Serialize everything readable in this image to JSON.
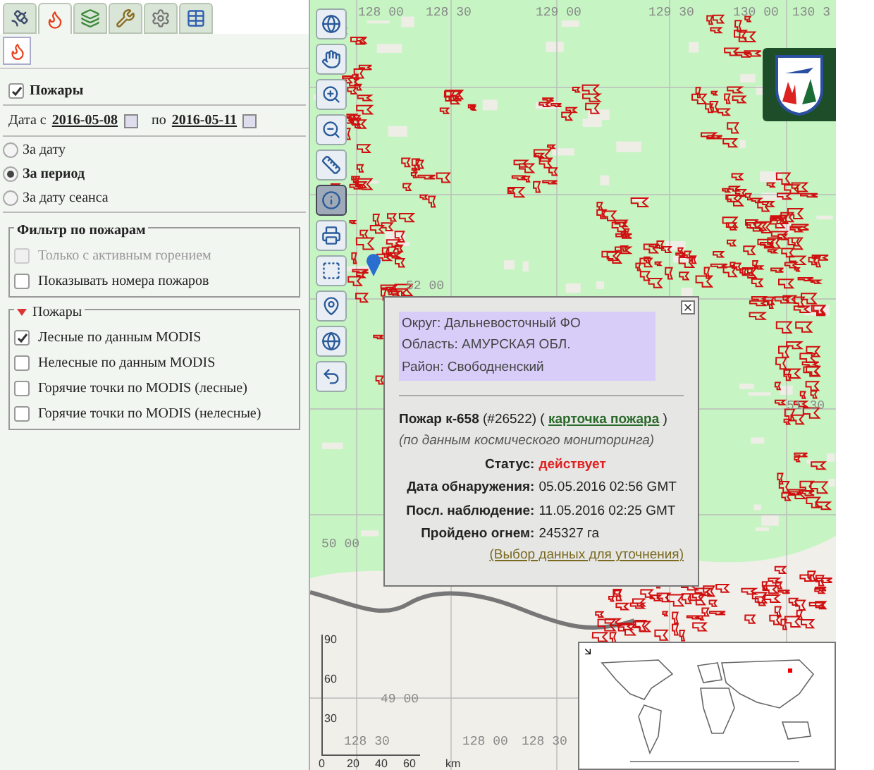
{
  "tabs": [
    {
      "kind": "satellite",
      "selected": false
    },
    {
      "kind": "fire",
      "selected": true
    },
    {
      "kind": "layers",
      "selected": false
    },
    {
      "kind": "tools",
      "selected": false
    },
    {
      "kind": "settings",
      "selected": false
    },
    {
      "kind": "table",
      "selected": false
    }
  ],
  "subtabs": [
    {
      "kind": "fire",
      "selected": true
    }
  ],
  "layer": {
    "label": "Пожары",
    "checked": true
  },
  "date_range": {
    "from_label": "Дата с",
    "from": "2016-05-08",
    "to_label": "по",
    "to": "2016-05-11"
  },
  "modes": [
    {
      "label": "За дату",
      "selected": false
    },
    {
      "label": "За период",
      "selected": true
    },
    {
      "label": "За дату сеанса",
      "selected": false
    }
  ],
  "filter": {
    "title": "Фильтр по пожарам",
    "options": [
      {
        "label": "Только с активным горением",
        "checked": false,
        "disabled": true
      },
      {
        "label": "Показывать номера пожаров",
        "checked": false,
        "disabled": false
      }
    ]
  },
  "fires_group": {
    "title": "Пожары",
    "expanded": true,
    "options": [
      {
        "label": "Лесные по данным MODIS",
        "checked": true
      },
      {
        "label": "Нелесные по данным MODIS",
        "checked": false
      },
      {
        "label": "Горячие точки по MODIS (лесные)",
        "checked": false
      },
      {
        "label": "Горячие точки по MODIS (нелесные)",
        "checked": false
      }
    ]
  },
  "map": {
    "toolbar": [
      {
        "kind": "zoom-world",
        "selected": false
      },
      {
        "kind": "pan",
        "selected": false
      },
      {
        "kind": "zoom-box",
        "selected": false
      },
      {
        "kind": "zoom-out",
        "selected": false
      },
      {
        "kind": "ruler",
        "selected": false
      },
      {
        "kind": "info",
        "selected": true
      },
      {
        "kind": "print",
        "selected": false
      },
      {
        "kind": "select",
        "selected": false
      },
      {
        "kind": "pin",
        "selected": false
      },
      {
        "kind": "globe",
        "selected": false
      },
      {
        "kind": "undo",
        "selected": false
      }
    ],
    "grid_labels": [
      "128 00",
      "128 30",
      "129 00",
      "129 30",
      "130 00",
      "130 3",
      "52 00",
      "51 30",
      "50 00",
      "49 00",
      "128 30",
      "128 00",
      "128 30"
    ],
    "popup": {
      "region_lines": [
        "Округ: Дальневосточный ФО",
        "Область: АМУРСКАЯ ОБЛ.",
        "Район: Свободненский"
      ],
      "heading": "**Пожар к-658** (#26522) (",
      "card_link": "карточка пожара",
      "heading_end": ")",
      "source": "(по данным космического мониторинга)",
      "fields": [
        {
          "label": "Статус:",
          "value": "действует",
          "kind": "status"
        },
        {
          "label": "Дата обнаружения:",
          "value": "05.05.2016 02:56 GMT",
          "kind": "plain"
        },
        {
          "label": "Посл. наблюдение:",
          "value": "11.05.2016 02:25 GMT",
          "kind": "plain"
        },
        {
          "label": "Пройдено огнем:",
          "value": "245327 га",
          "kind": "plain"
        }
      ],
      "refine_link": "(Выбор данных для уточнения)"
    },
    "scale": {
      "vertical": [
        "90",
        "60",
        "30"
      ],
      "horizontal": [
        "0",
        "20",
        "40",
        "60"
      ],
      "unit": "km"
    }
  }
}
